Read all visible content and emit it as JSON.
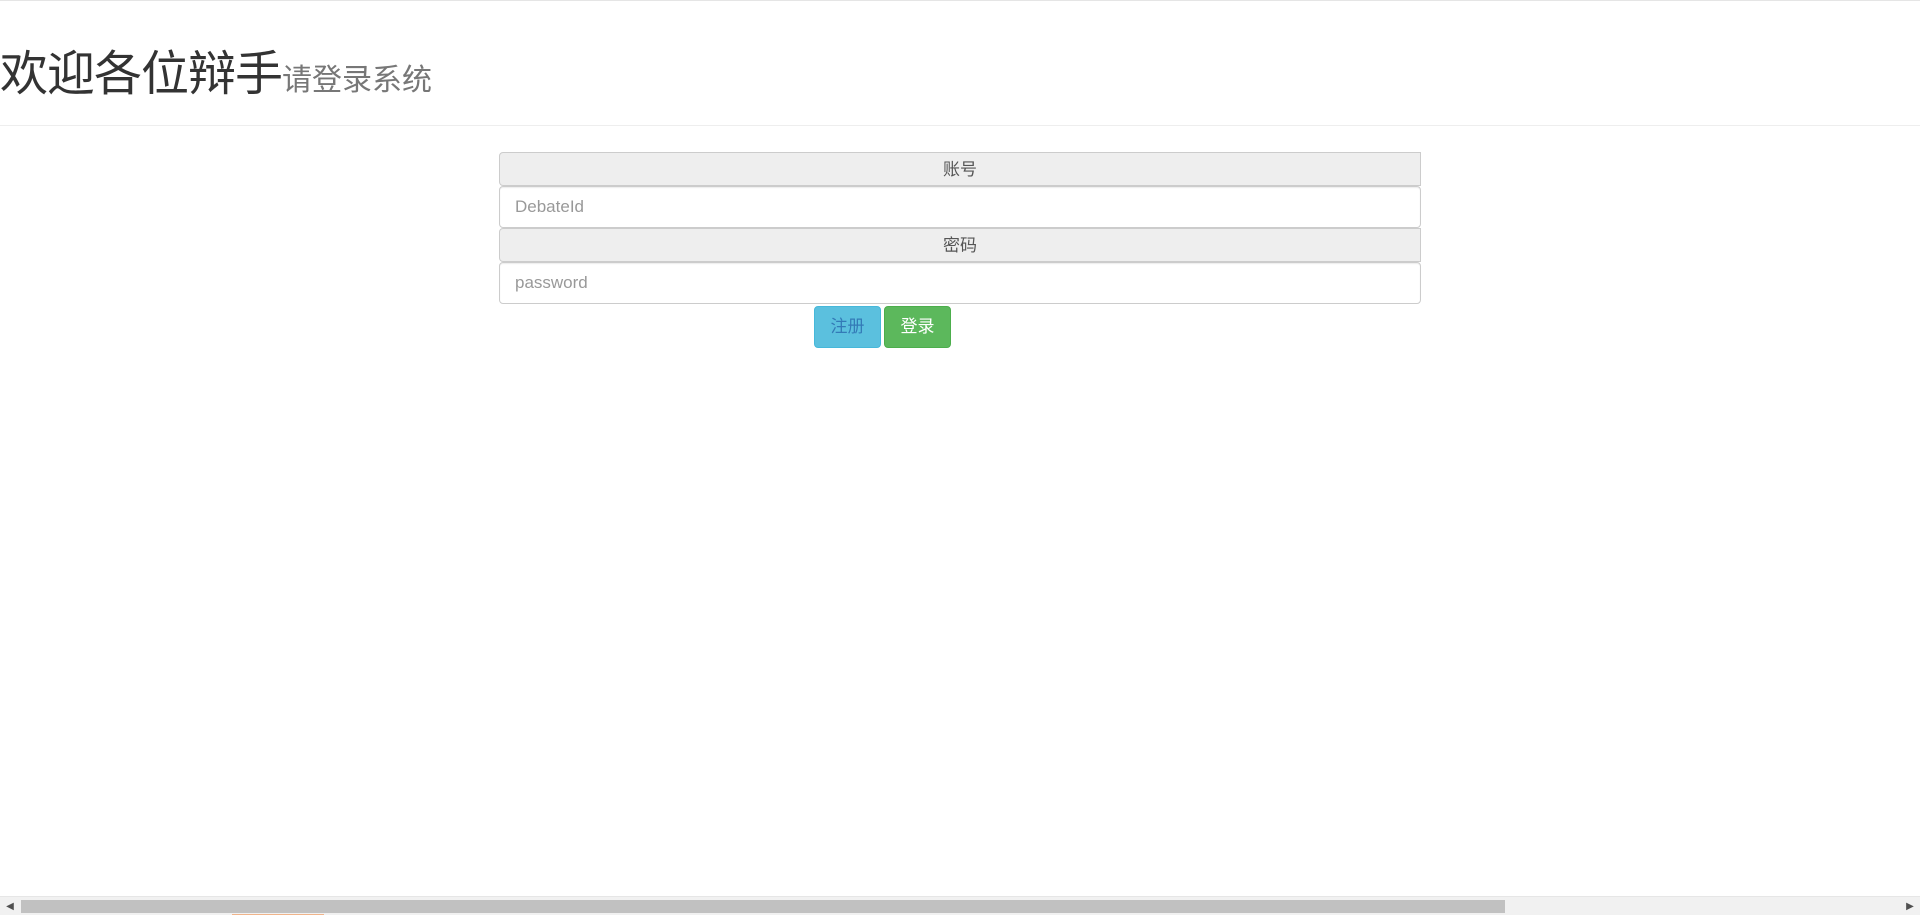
{
  "header": {
    "title": "欢迎各位辩手",
    "subtitle": "请登录系统"
  },
  "login_form": {
    "account_label": "账号",
    "account_placeholder": "DebateId",
    "account_value": "",
    "password_label": "密码",
    "password_placeholder": "password",
    "password_value": ""
  },
  "actions": {
    "register_label": "注册",
    "login_label": "登录"
  },
  "scrollbar": {
    "left_arrow": "◀",
    "right_arrow": "▶",
    "left_icon": "scroll-left-arrow-icon",
    "right_icon": "scroll-right-arrow-icon"
  },
  "colors": {
    "register_button": "#5bc0de",
    "login_button": "#5cb85c",
    "addon_background": "#eeeeee"
  }
}
